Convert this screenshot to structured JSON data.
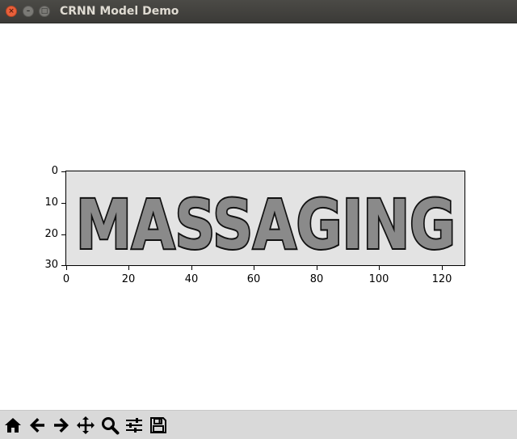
{
  "window": {
    "title": "CRNN Model Demo",
    "close_glyph": "×",
    "minimize_glyph": "–",
    "maximize_glyph": "□"
  },
  "figure": {
    "image_text": "MASSAGING",
    "y_ticks": [
      "0",
      "10",
      "20",
      "30"
    ],
    "x_ticks": [
      "0",
      "20",
      "40",
      "60",
      "80",
      "100",
      "120"
    ]
  },
  "toolbar": {
    "buttons": [
      {
        "name": "home-icon",
        "label": "Home"
      },
      {
        "name": "back-icon",
        "label": "Back"
      },
      {
        "name": "forward-icon",
        "label": "Forward"
      },
      {
        "name": "pan-icon",
        "label": "Pan"
      },
      {
        "name": "zoom-icon",
        "label": "Zoom"
      },
      {
        "name": "subplots-icon",
        "label": "Configure subplots"
      },
      {
        "name": "save-icon",
        "label": "Save"
      }
    ]
  }
}
